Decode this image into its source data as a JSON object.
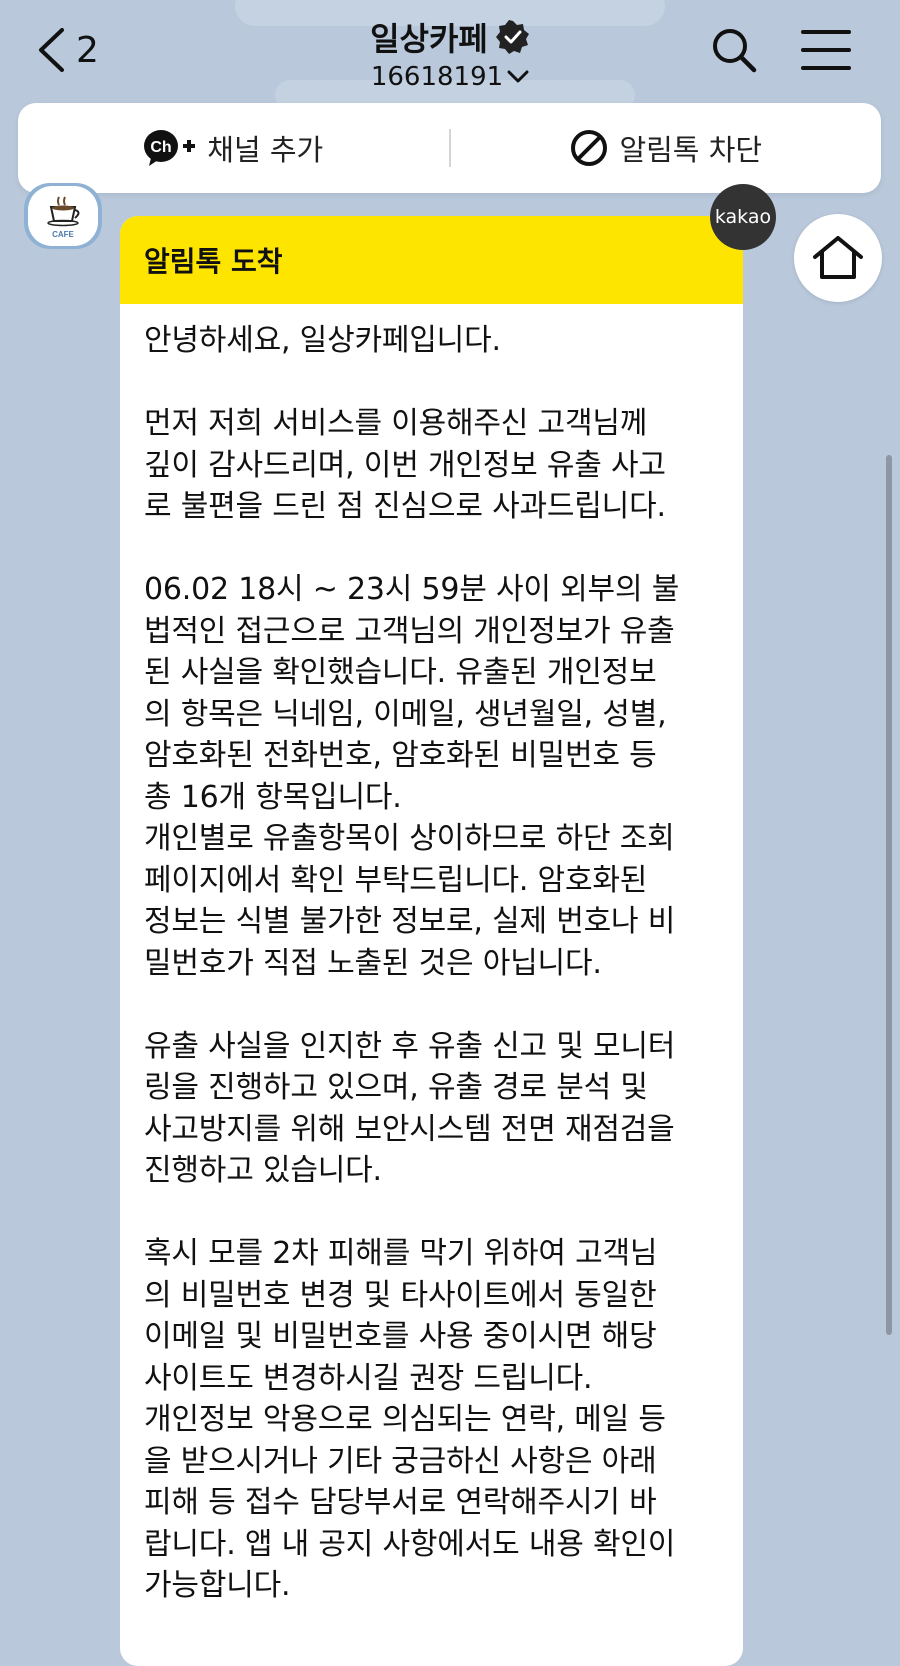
{
  "header": {
    "back_count": "2",
    "channel_name": "일상카페",
    "channel_id": "16618191"
  },
  "actions": {
    "add_channel": "채널 추가",
    "block_alimtalk": "알림톡 차단",
    "ch_badge_text": "Ch"
  },
  "profile": {
    "avatar_text": "CAFE"
  },
  "message": {
    "badge": "kakao",
    "title": "알림톡 도착",
    "paragraphs": [
      [
        "안녕하세요, 일상카페입니다."
      ],
      [
        "먼저 저희 서비스를 이용해주신 고객님께",
        "깊이 감사드리며, 이번 개인정보 유출 사고",
        "로 불편을 드린 점 진심으로 사과드립니다."
      ],
      [
        "06.02 18시 ~ 23시 59분 사이 외부의 불",
        "법적인 접근으로 고객님의 개인정보가 유출",
        "된 사실을 확인했습니다. 유출된 개인정보",
        "의 항목은 닉네임, 이메일, 생년월일, 성별,",
        "암호화된 전화번호, 암호화된 비밀번호 등",
        "총 16개 항목입니다.",
        "개인별로 유출항목이 상이하므로 하단 조회",
        " 페이지에서 확인 부탁드립니다. 암호화된",
        "정보는 식별 불가한 정보로, 실제 번호나 비",
        "밀번호가 직접 노출된 것은 아닙니다."
      ],
      [
        "유출 사실을 인지한 후 유출 신고 및 모니터",
        "링을 진행하고 있으며, 유출 경로 분석 및",
        "사고방지를 위해 보안시스템 전면 재점검을",
        " 진행하고 있습니다."
      ],
      [
        "혹시 모를 2차 피해를 막기 위하여 고객님",
        "의 비밀번호 변경 및 타사이트에서 동일한",
        "이메일 및 비밀번호를 사용 중이시면 해당",
        "사이트도 변경하시길 권장 드립니다.",
        "개인정보 악용으로 의심되는 연락, 메일 등",
        "을 받으시거나 기타 궁금하신 사항은 아래",
        "피해 등 접수 담당부서로 연락해주시기 바",
        "랍니다. 앱 내 공지 사항에서도 내용 확인이",
        " 가능합니다."
      ]
    ]
  },
  "colors": {
    "background": "#b9c9db",
    "header_yellow": "#fee500",
    "kakao_badge": "#333333"
  }
}
